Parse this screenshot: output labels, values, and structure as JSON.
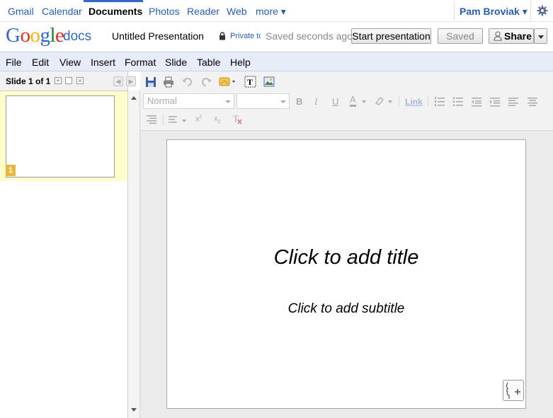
{
  "topnav": {
    "items": [
      "Gmail",
      "Calendar",
      "Documents",
      "Photos",
      "Reader",
      "Web",
      "more ▾"
    ],
    "user": "Pam Broviak ▾"
  },
  "header": {
    "logo_text": "Google",
    "logo_suffix": "docs",
    "doc_title": "Untitled Presentation",
    "privacy": "Private to only me",
    "save_status": "Saved seconds ago",
    "start_presentation": "Start presentation",
    "saved_button": "Saved",
    "share_button": "Share"
  },
  "menu": [
    "File",
    "Edit",
    "View",
    "Insert",
    "Format",
    "Slide",
    "Table",
    "Help"
  ],
  "slide_panel": {
    "slide_count": "Slide 1 of 1",
    "thumbnail_number": "1"
  },
  "toolbar": {
    "style_select": "Normal",
    "link_label": "Link",
    "bold": "B",
    "italic": "I",
    "underline": "U",
    "text_color": "A"
  },
  "slide": {
    "title_placeholder": "Click to add title",
    "subtitle_placeholder": "Click to add subtitle"
  },
  "colors": {
    "link_blue": "#2a5db0",
    "menubar_bg": "#e6ecf8",
    "thumb_highlight": "#ffffcc",
    "thumb_badge": "#e8b63a"
  }
}
